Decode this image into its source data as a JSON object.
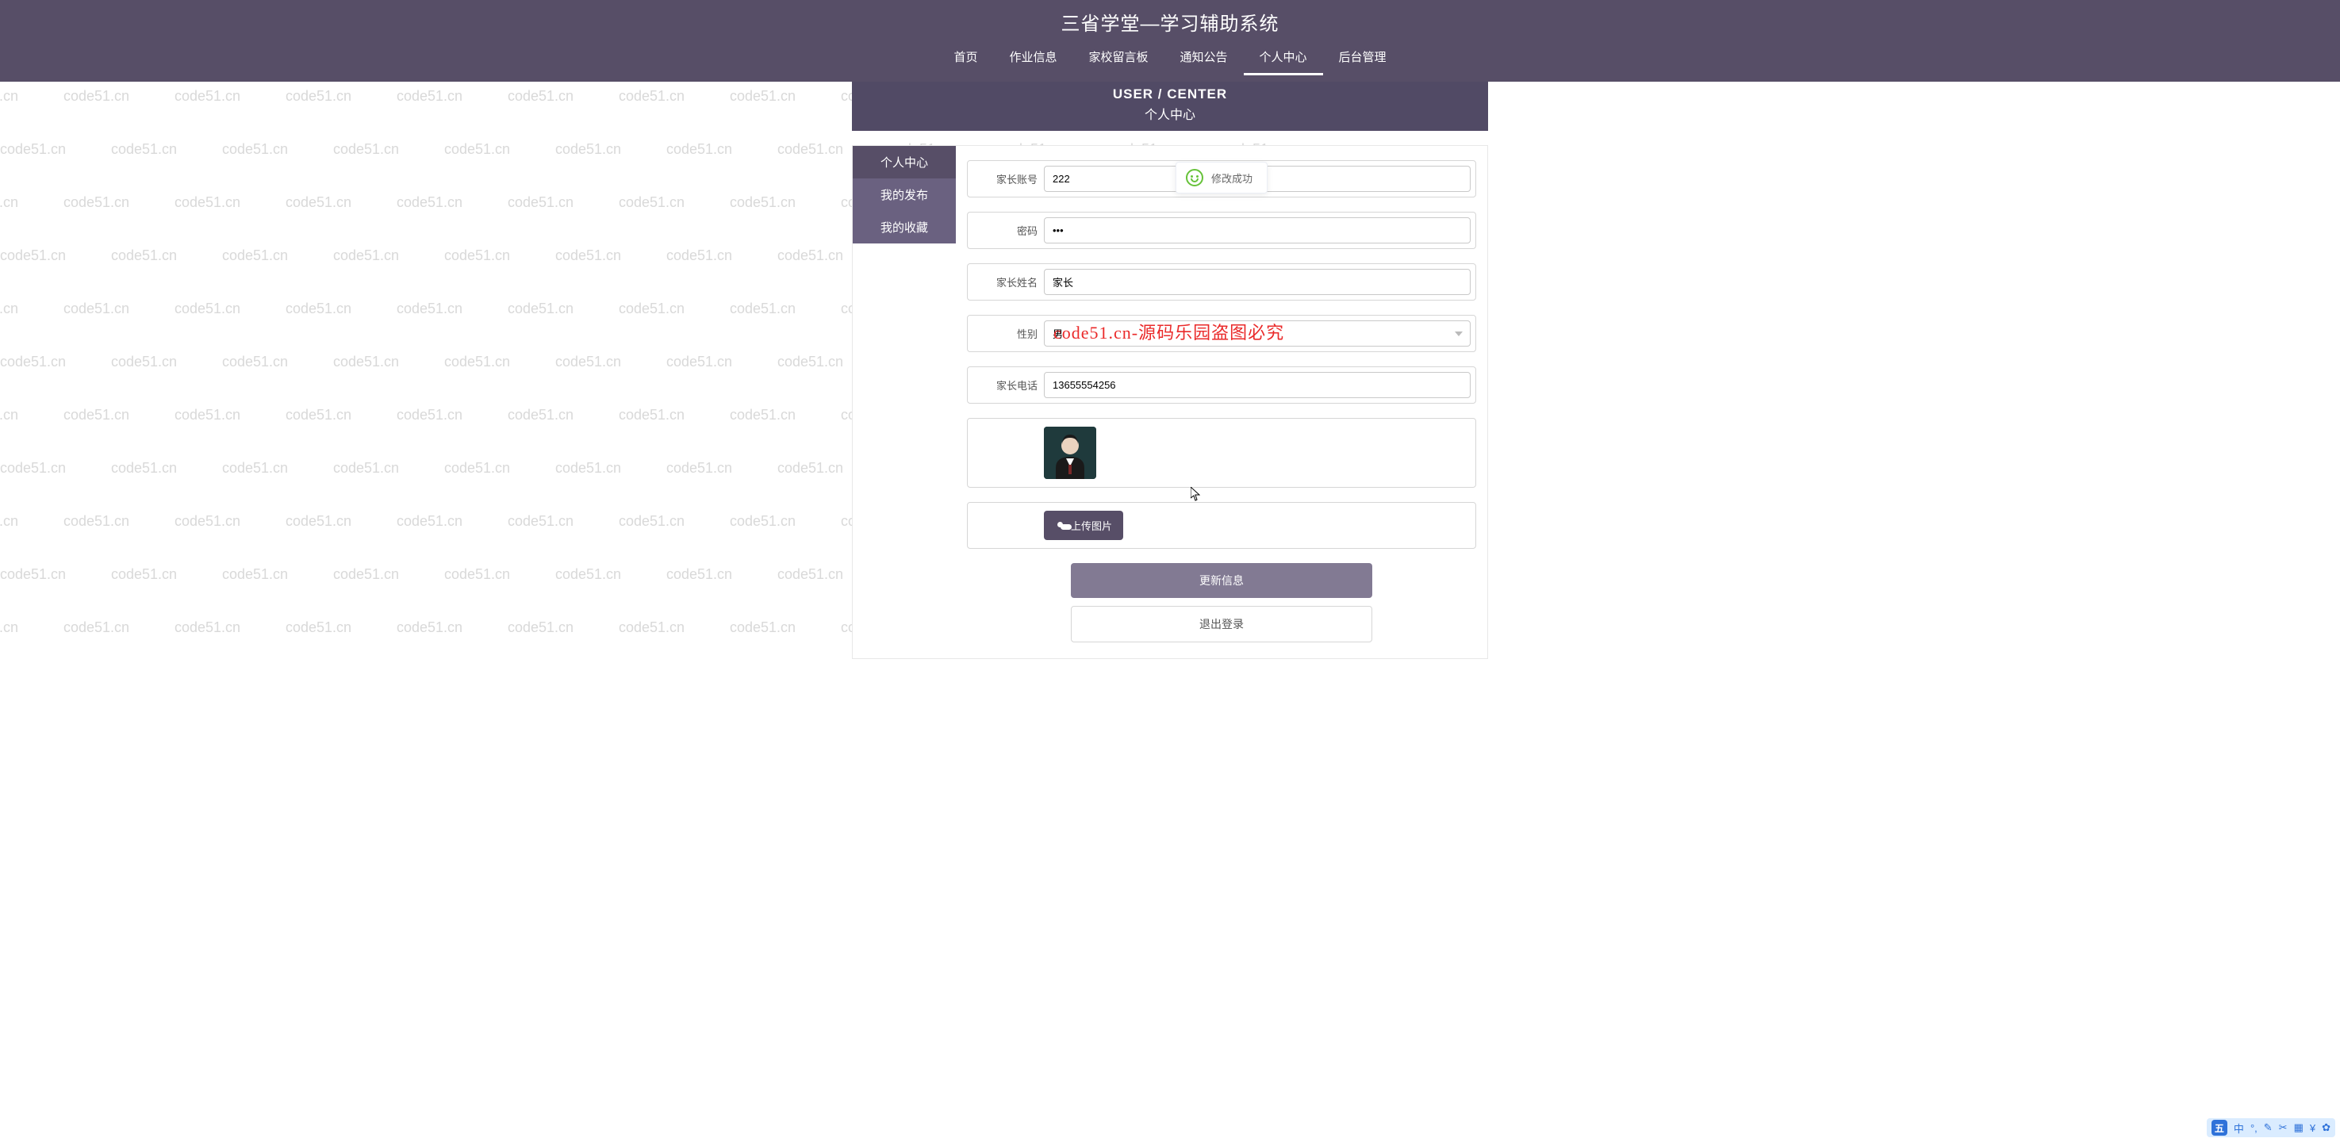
{
  "watermark_text": "code51.cn",
  "header": {
    "title": "三省学堂—学习辅助系统"
  },
  "nav": {
    "items": [
      {
        "label": "首页"
      },
      {
        "label": "作业信息"
      },
      {
        "label": "家校留言板"
      },
      {
        "label": "通知公告"
      },
      {
        "label": "个人中心",
        "active": true
      },
      {
        "label": "后台管理"
      }
    ]
  },
  "band": {
    "en": "USER / CENTER",
    "cn": "个人中心"
  },
  "sidebar": {
    "items": [
      {
        "label": "个人中心",
        "active": true
      },
      {
        "label": "我的发布"
      },
      {
        "label": "我的收藏"
      }
    ]
  },
  "toast": {
    "text": "修改成功"
  },
  "form": {
    "account": {
      "label": "家长账号",
      "value": "222"
    },
    "password": {
      "label": "密码",
      "value": "•••"
    },
    "name": {
      "label": "家长姓名",
      "value": "家长"
    },
    "gender": {
      "label": "性别",
      "value": "男"
    },
    "phone": {
      "label": "家长电话",
      "value": "13655554256"
    },
    "upload": {
      "label": "上传图片"
    },
    "update": {
      "label": "更新信息"
    },
    "logout": {
      "label": "退出登录"
    }
  },
  "red_stamp": "code51.cn-源码乐园盗图必究",
  "tray": {
    "badge": "五",
    "items": [
      "中",
      "°,",
      "✎",
      "✂",
      "▦",
      "¥",
      "✿"
    ]
  }
}
